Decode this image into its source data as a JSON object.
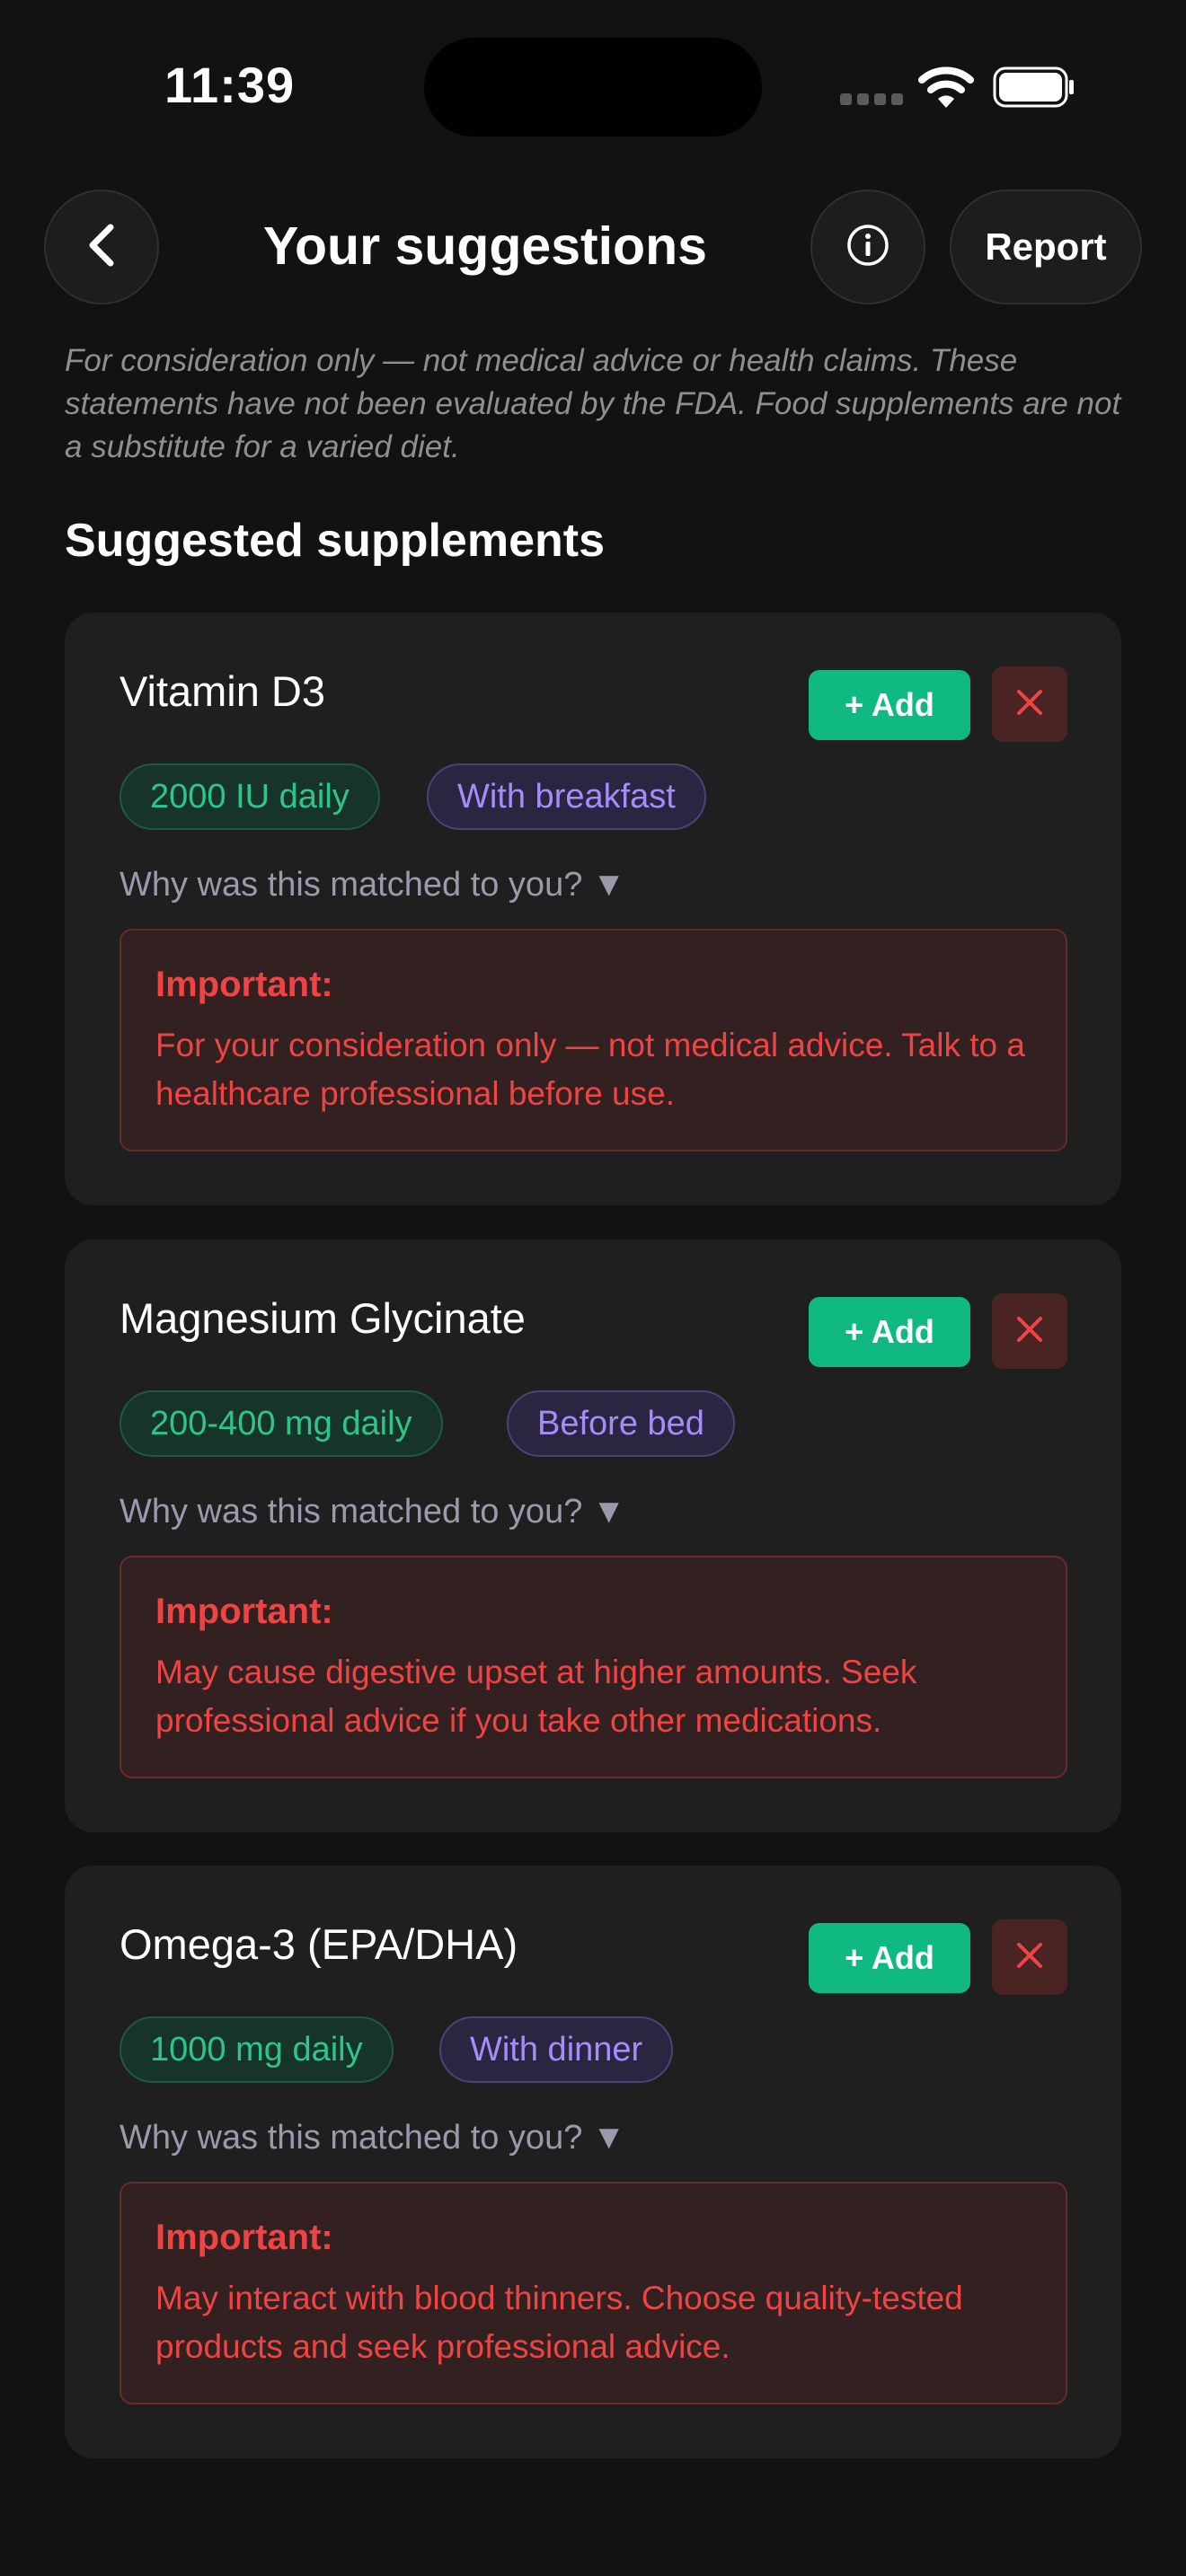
{
  "status_bar": {
    "time": "11:39",
    "icons": [
      "signal-icon",
      "wifi-icon",
      "battery-icon"
    ]
  },
  "header": {
    "back_icon": "chevron-left-icon",
    "title": "Your suggestions",
    "info_icon": "info-icon",
    "report_label": "Report"
  },
  "disclaimer": "For consideration only — not medical advice or health claims. These statements have not been evaluated by the FDA. Food supplements are not a substitute for a varied diet.",
  "section_title": "Suggested supplements",
  "colors": {
    "background": "#121212",
    "card": "#1f1f1f",
    "add_button": "#10b981",
    "dose_text": "#2fc48d",
    "timing_text": "#a78bfa",
    "warning_text": "#ef4444"
  },
  "cards": [
    {
      "name": "Vitamin D3",
      "add_label": "+ Add",
      "dismiss_icon": "close-icon",
      "dose": "2000 IU daily",
      "timing": "With breakfast",
      "why": "Why was this matched to you? ▼",
      "warning_heading": "Important:",
      "warning_text": "For your consideration only — not medical advice. Talk to a healthcare professional before use."
    },
    {
      "name": "Magnesium Glycinate",
      "add_label": "+ Add",
      "dismiss_icon": "close-icon",
      "dose": "200-400 mg daily",
      "timing": "Before bed",
      "why": "Why was this matched to you? ▼",
      "warning_heading": "Important:",
      "warning_text": "May cause digestive upset at higher amounts. Seek professional advice if you take other medications."
    },
    {
      "name": "Omega-3 (EPA/DHA)",
      "add_label": "+ Add",
      "dismiss_icon": "close-icon",
      "dose": "1000 mg daily",
      "timing": "With dinner",
      "why": "Why was this matched to you? ▼",
      "warning_heading": "Important:",
      "warning_text": "May interact with blood thinners. Choose quality-tested products and seek professional advice."
    }
  ]
}
